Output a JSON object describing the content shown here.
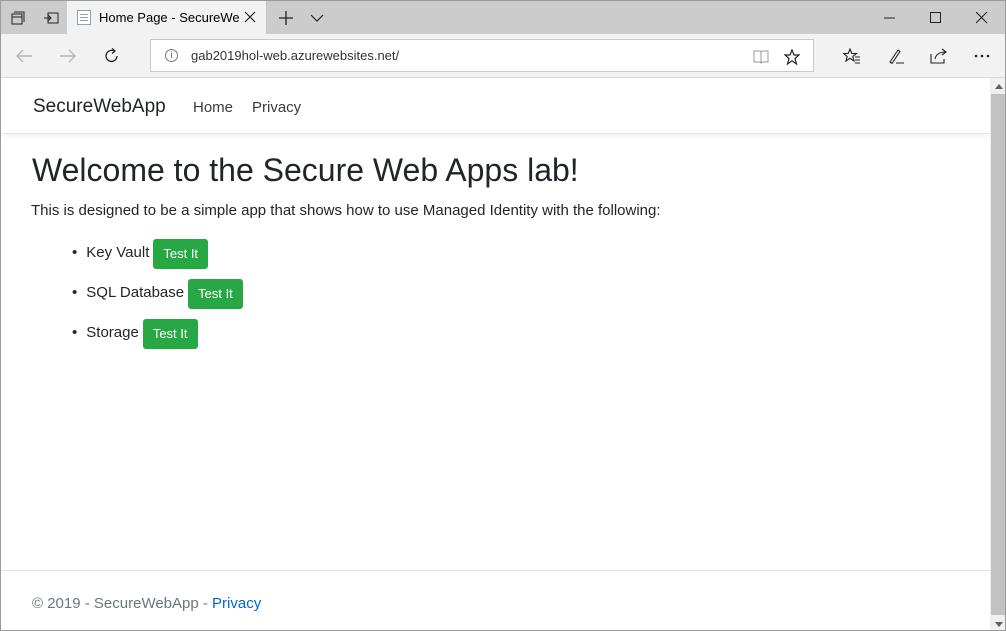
{
  "browser": {
    "tab_title": "Home Page - SecureWe",
    "url": "gab2019hol-web.azurewebsites.net/",
    "icons": [
      "tab-actions-icon",
      "set-aside-tabs-icon",
      "page-icon",
      "close-icon",
      "new-tab-icon",
      "tab-list-chevron-icon",
      "minimize-icon",
      "maximize-icon",
      "close-window-icon",
      "back-icon",
      "forward-icon",
      "refresh-icon",
      "info-icon",
      "reading-view-icon",
      "favorite-star-icon",
      "favorites-icon",
      "pen-icon",
      "share-icon",
      "more-icon"
    ]
  },
  "site": {
    "brand": "SecureWebApp",
    "nav": [
      "Home",
      "Privacy"
    ],
    "heading": "Welcome to the Secure Web Apps lab!",
    "intro": "This is designed to be a simple app that shows how to use Managed Identity with the following:",
    "items": [
      {
        "label": "Key Vault",
        "button": "Test It"
      },
      {
        "label": "SQL Database",
        "button": "Test It"
      },
      {
        "label": "Storage",
        "button": "Test It"
      }
    ],
    "bullet": "•",
    "footer": {
      "text": "© 2019 - SecureWebApp - ",
      "link": "Privacy"
    }
  },
  "colors": {
    "button_green": "#28a745",
    "link_blue": "#0366d6",
    "titlebar_gray": "#cccccc"
  }
}
